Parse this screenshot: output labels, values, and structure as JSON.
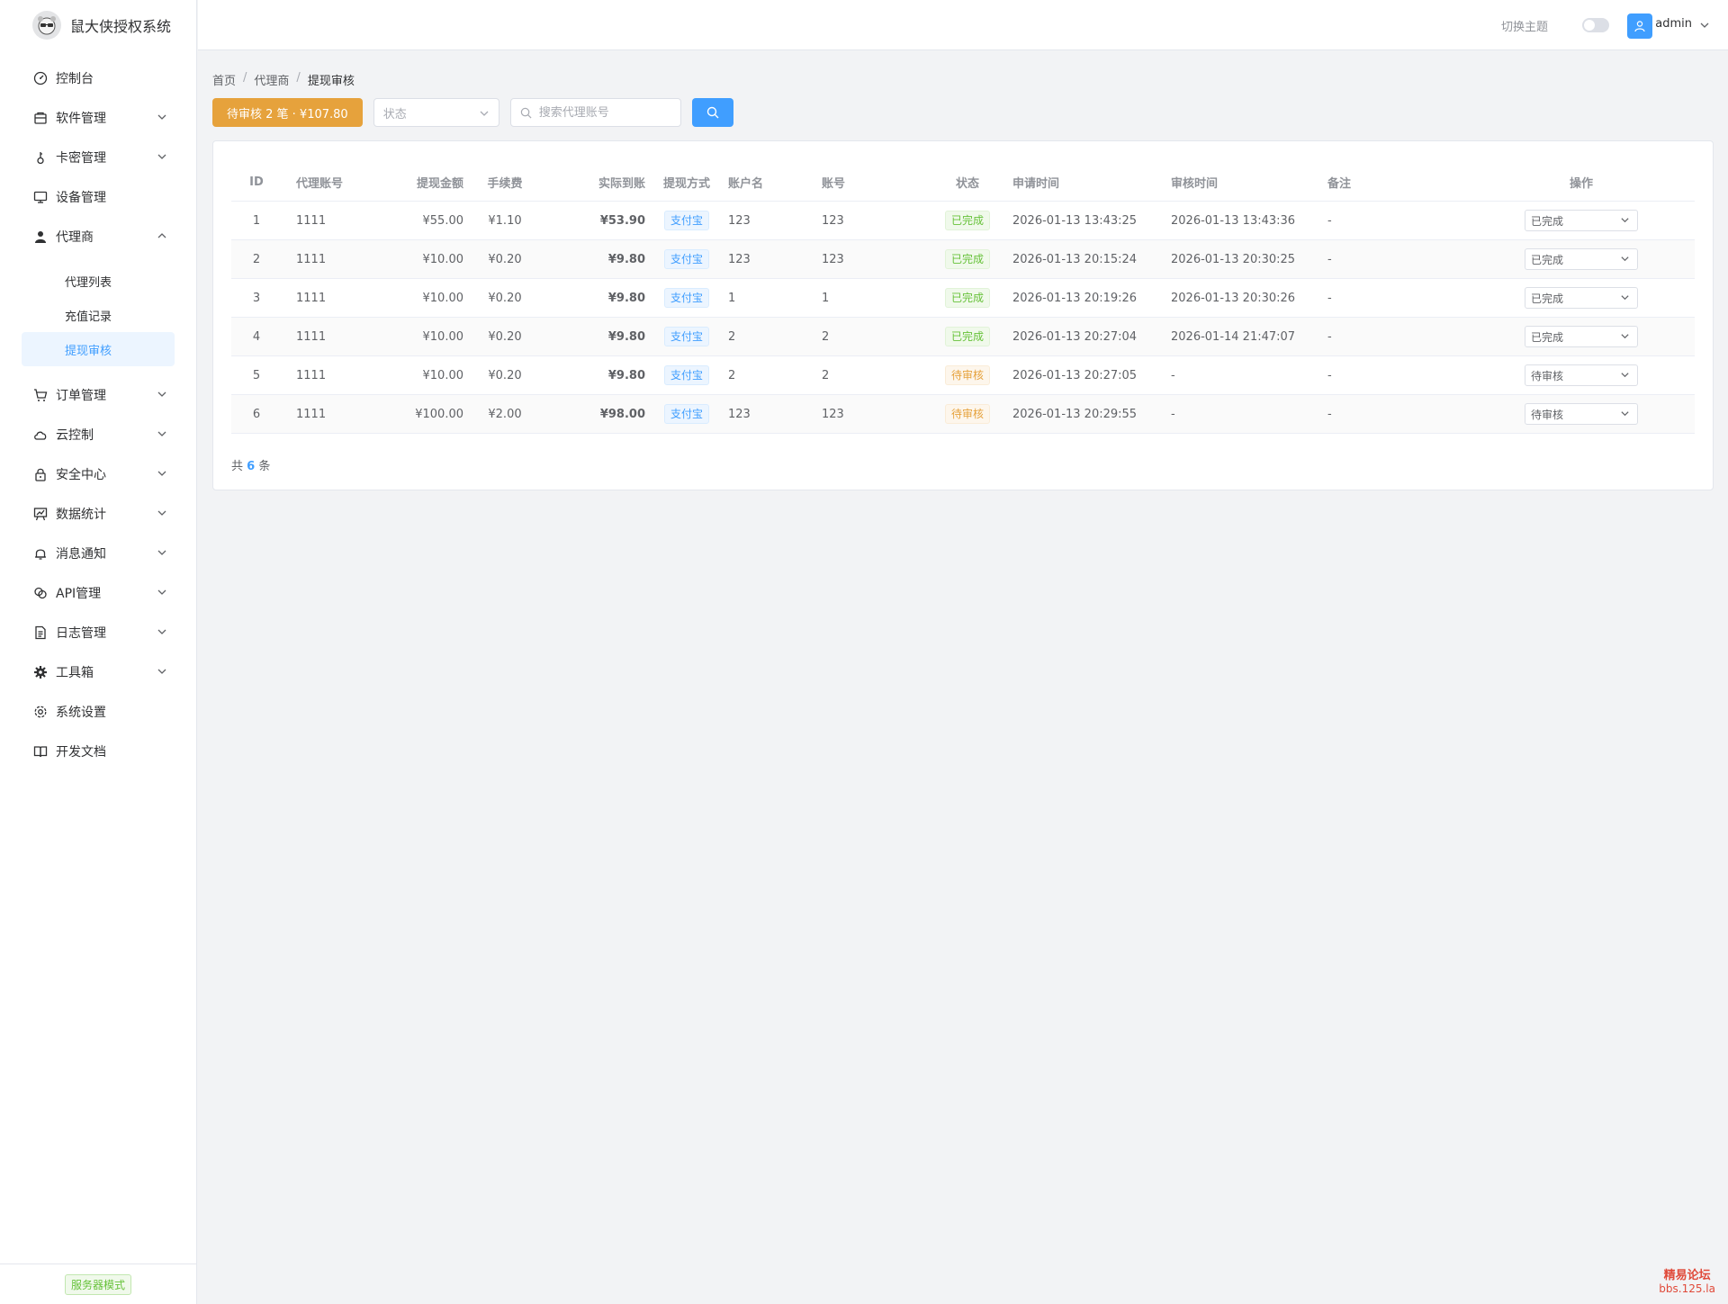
{
  "app": {
    "title": "鼠大侠授权系统"
  },
  "sidebar": {
    "items": [
      {
        "label": "控制台",
        "icon": "dashboard-icon",
        "has_children": false
      },
      {
        "label": "软件管理",
        "icon": "package-icon",
        "has_children": true
      },
      {
        "label": "卡密管理",
        "icon": "key-icon",
        "has_children": true
      },
      {
        "label": "设备管理",
        "icon": "monitor-icon",
        "has_children": false
      },
      {
        "label": "代理商",
        "icon": "user-icon",
        "has_children": true,
        "expanded": true,
        "children": [
          {
            "label": "代理列表",
            "active": false
          },
          {
            "label": "充值记录",
            "active": false
          },
          {
            "label": "提现审核",
            "active": true
          }
        ]
      },
      {
        "label": "订单管理",
        "icon": "cart-icon",
        "has_children": true
      },
      {
        "label": "云控制",
        "icon": "cloud-icon",
        "has_children": true
      },
      {
        "label": "安全中心",
        "icon": "lock-icon",
        "has_children": true
      },
      {
        "label": "数据统计",
        "icon": "chart-icon",
        "has_children": true
      },
      {
        "label": "消息通知",
        "icon": "bell-icon",
        "has_children": true
      },
      {
        "label": "API管理",
        "icon": "link-icon",
        "has_children": true
      },
      {
        "label": "日志管理",
        "icon": "document-icon",
        "has_children": true
      },
      {
        "label": "工具箱",
        "icon": "tool-icon",
        "has_children": true
      },
      {
        "label": "系统设置",
        "icon": "gear-icon",
        "has_children": false
      },
      {
        "label": "开发文档",
        "icon": "book-icon",
        "has_children": false
      }
    ],
    "mode_badge": "服务器模式"
  },
  "header": {
    "theme_label": "切换主题",
    "user": "admin"
  },
  "breadcrumb": [
    "首页",
    "代理商",
    "提现审核"
  ],
  "toolbar": {
    "pending_label": "待审核 2 笔 · ¥107.80",
    "status_placeholder": "状态",
    "search_placeholder": "搜索代理账号"
  },
  "table": {
    "columns": [
      "ID",
      "代理账号",
      "提现金额",
      "手续费",
      "实际到账",
      "提现方式",
      "账户名",
      "账号",
      "状态",
      "申请时间",
      "审核时间",
      "备注",
      "操作"
    ],
    "rows": [
      {
        "id": "1",
        "account": "1111",
        "amount": "¥55.00",
        "fee": "¥1.10",
        "actual": "¥53.90",
        "method": "支付宝",
        "account_name": "123",
        "account_no": "123",
        "status": "已完成",
        "status_type": "done",
        "apply_time": "2026-01-13 13:43:25",
        "review_time": "2026-01-13 13:43:36",
        "remark": "-",
        "op": "已完成"
      },
      {
        "id": "2",
        "account": "1111",
        "amount": "¥10.00",
        "fee": "¥0.20",
        "actual": "¥9.80",
        "method": "支付宝",
        "account_name": "123",
        "account_no": "123",
        "status": "已完成",
        "status_type": "done",
        "apply_time": "2026-01-13 20:15:24",
        "review_time": "2026-01-13 20:30:25",
        "remark": "-",
        "op": "已完成"
      },
      {
        "id": "3",
        "account": "1111",
        "amount": "¥10.00",
        "fee": "¥0.20",
        "actual": "¥9.80",
        "method": "支付宝",
        "account_name": "1",
        "account_no": "1",
        "status": "已完成",
        "status_type": "done",
        "apply_time": "2026-01-13 20:19:26",
        "review_time": "2026-01-13 20:30:26",
        "remark": "-",
        "op": "已完成"
      },
      {
        "id": "4",
        "account": "1111",
        "amount": "¥10.00",
        "fee": "¥0.20",
        "actual": "¥9.80",
        "method": "支付宝",
        "account_name": "2",
        "account_no": "2",
        "status": "已完成",
        "status_type": "done",
        "apply_time": "2026-01-13 20:27:04",
        "review_time": "2026-01-14 21:47:07",
        "remark": "-",
        "op": "已完成"
      },
      {
        "id": "5",
        "account": "1111",
        "amount": "¥10.00",
        "fee": "¥0.20",
        "actual": "¥9.80",
        "method": "支付宝",
        "account_name": "2",
        "account_no": "2",
        "status": "待审核",
        "status_type": "pending",
        "apply_time": "2026-01-13 20:27:05",
        "review_time": "-",
        "remark": "-",
        "op": "待审核"
      },
      {
        "id": "6",
        "account": "1111",
        "amount": "¥100.00",
        "fee": "¥2.00",
        "actual": "¥98.00",
        "method": "支付宝",
        "account_name": "123",
        "account_no": "123",
        "status": "待审核",
        "status_type": "pending",
        "apply_time": "2026-01-13 20:29:55",
        "review_time": "-",
        "remark": "-",
        "op": "待审核"
      }
    ]
  },
  "pagination": {
    "prefix": "共",
    "count": "6",
    "suffix": "条"
  },
  "watermark": {
    "line1": "精易论坛",
    "line2": "bbs.125.la"
  },
  "colors": {
    "primary": "#409eff",
    "warning": "#e6a23c",
    "success": "#67c23a",
    "danger": "#f56c6c"
  }
}
